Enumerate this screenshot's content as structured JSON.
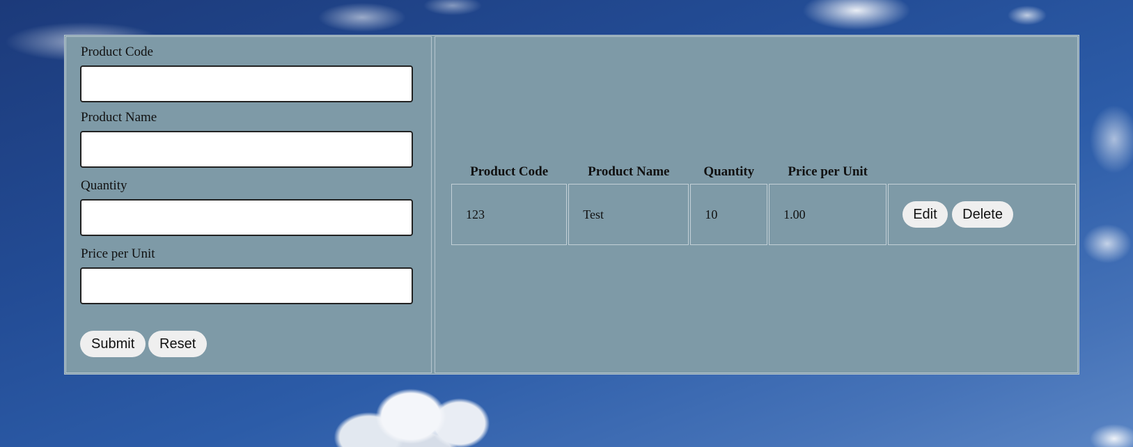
{
  "form": {
    "product_code_label": "Product Code",
    "product_code_value": "",
    "product_name_label": "Product Name",
    "product_name_value": "",
    "quantity_label": "Quantity",
    "quantity_value": "",
    "price_label": "Price per Unit",
    "price_value": "",
    "submit_label": "Submit",
    "reset_label": "Reset"
  },
  "table": {
    "headers": [
      "Product Code",
      "Product Name",
      "Quantity",
      "Price per Unit"
    ],
    "rows": [
      {
        "code": "123",
        "name": "Test",
        "quantity": "10",
        "price": "1.00",
        "edit_label": "Edit",
        "delete_label": "Delete"
      }
    ]
  },
  "colors": {
    "panel_background": "#7e9aa7",
    "panel_border": "#b7c6cf",
    "button_background": "#efefef"
  }
}
